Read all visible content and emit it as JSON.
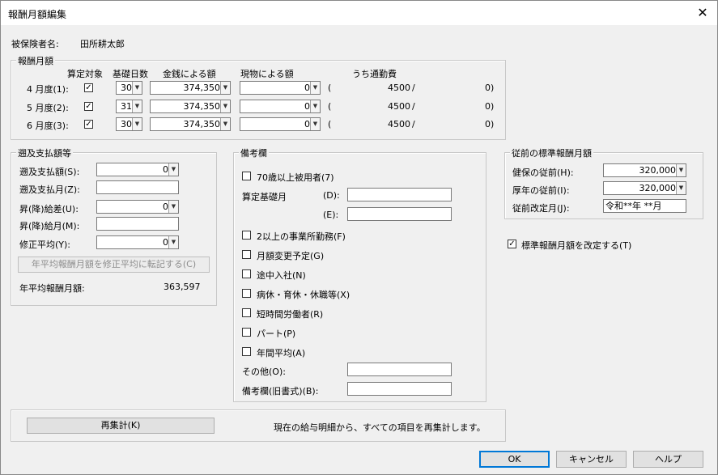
{
  "window": {
    "title": "報酬月額編集",
    "close_glyph": "✕"
  },
  "insured": {
    "label": "被保険者名:",
    "name": "田所耕太郎"
  },
  "salary": {
    "group_label": "報酬月額",
    "headers": {
      "target": "算定対象",
      "days": "基礎日数",
      "cash": "金銭による額",
      "kind": "現物による額",
      "commute": "うち通勤費"
    },
    "rows": [
      {
        "label": "4 月度(1):",
        "checked": "✓",
        "days": "30",
        "cash": "374,350",
        "kind": "0",
        "paren": "(",
        "commute": "4500",
        "slash": "/",
        "commute2": "0)"
      },
      {
        "label": "5 月度(2):",
        "checked": "✓",
        "days": "31",
        "cash": "374,350",
        "kind": "0",
        "paren": "(",
        "commute": "4500",
        "slash": "/",
        "commute2": "0)"
      },
      {
        "label": "6 月度(3):",
        "checked": "✓",
        "days": "30",
        "cash": "374,350",
        "kind": "0",
        "paren": "(",
        "commute": "4500",
        "slash": "/",
        "commute2": "0)"
      }
    ]
  },
  "retro": {
    "group_label": "遡及支払額等",
    "amount_label": "遡及支払額(S):",
    "amount_value": "0",
    "month_label": "遡及支払月(Z):",
    "month_value": "",
    "diff_label": "昇(降)給差(U):",
    "diff_value": "0",
    "raise_month_label": "昇(降)給月(M):",
    "raise_month_value": "",
    "avg_label": "修正平均(Y):",
    "avg_value": "0",
    "transfer_button": "年平均報酬月額を修正平均に転記する(C)",
    "annual_label": "年平均報酬月額:",
    "annual_value": "363,597"
  },
  "remarks": {
    "group_label": "備考欄",
    "over70": "70歳以上被用者(7)",
    "base_month": "算定基礎月",
    "d_label": "(D):",
    "d_value": "",
    "e_label": "(E):",
    "e_value": "",
    "multi": "2以上の事業所勤務(F)",
    "change": "月額変更予定(G)",
    "midjoin": "途中入社(N)",
    "leave": "病休・育休・休職等(X)",
    "shorttime": "短時間労働者(R)",
    "part": "パート(P)",
    "annual": "年間平均(A)",
    "other_label": "その他(O):",
    "other_value": "",
    "old_label": "備考欄(旧書式)(B):",
    "old_value": ""
  },
  "previous": {
    "group_label": "従前の標準報酬月額",
    "health_label": "健保の従前(H):",
    "health_value": "320,000",
    "pension_label": "厚年の従前(I):",
    "pension_value": "320,000",
    "revised_label": "従前改定月(J):",
    "revised_value": "令和**年 **月"
  },
  "revise_check": {
    "checked": "✓",
    "label": "標準報酬月額を改定する(T)"
  },
  "recalc": {
    "button": "再集計(K)",
    "description": "現在の給与明細から、すべての項目を再集計します。"
  },
  "footer": {
    "ok": "OK",
    "cancel": "キャンセル",
    "help": "ヘルプ"
  }
}
